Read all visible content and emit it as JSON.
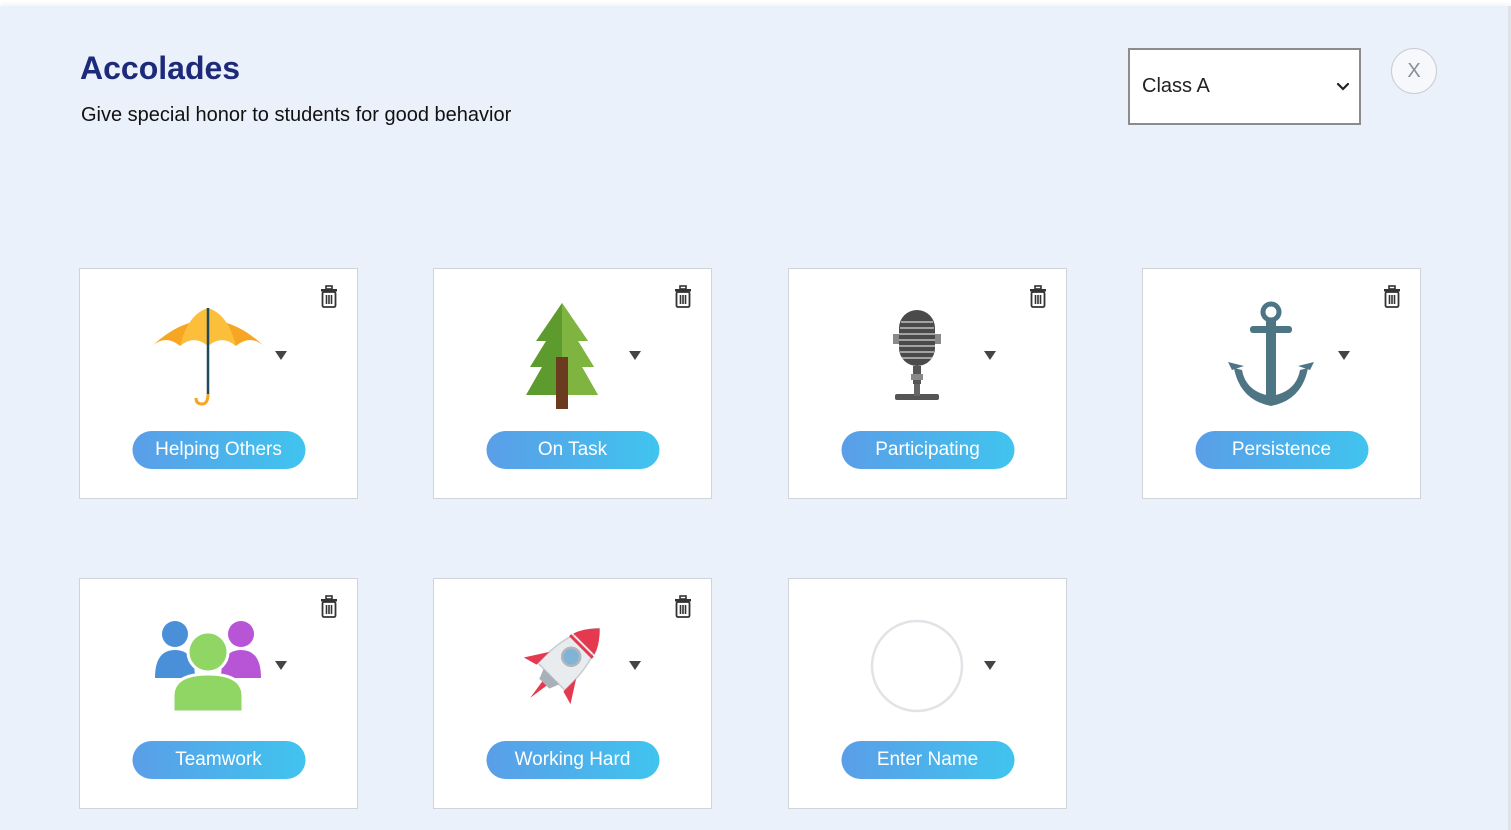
{
  "header": {
    "title": "Accolades",
    "subtitle": "Give special honor to students for good behavior"
  },
  "class_select": {
    "value": "Class A",
    "icon": "chevron-down-icon"
  },
  "close_button": {
    "label": "X"
  },
  "cards": [
    {
      "label": "Helping Others",
      "icon": "umbrella-icon"
    },
    {
      "label": "On Task",
      "icon": "tree-icon"
    },
    {
      "label": "Participating",
      "icon": "microphone-icon"
    },
    {
      "label": "Persistence",
      "icon": "anchor-icon"
    },
    {
      "label": "Teamwork",
      "icon": "teamwork-icon"
    },
    {
      "label": "Working Hard",
      "icon": "rocket-icon"
    },
    {
      "label": "Enter Name",
      "icon": "empty-circle-icon"
    }
  ],
  "colors": {
    "background": "#eaf1fb",
    "title": "#1d2a7a",
    "pill_start": "#5a9ee8",
    "pill_end": "#40c4ee"
  }
}
